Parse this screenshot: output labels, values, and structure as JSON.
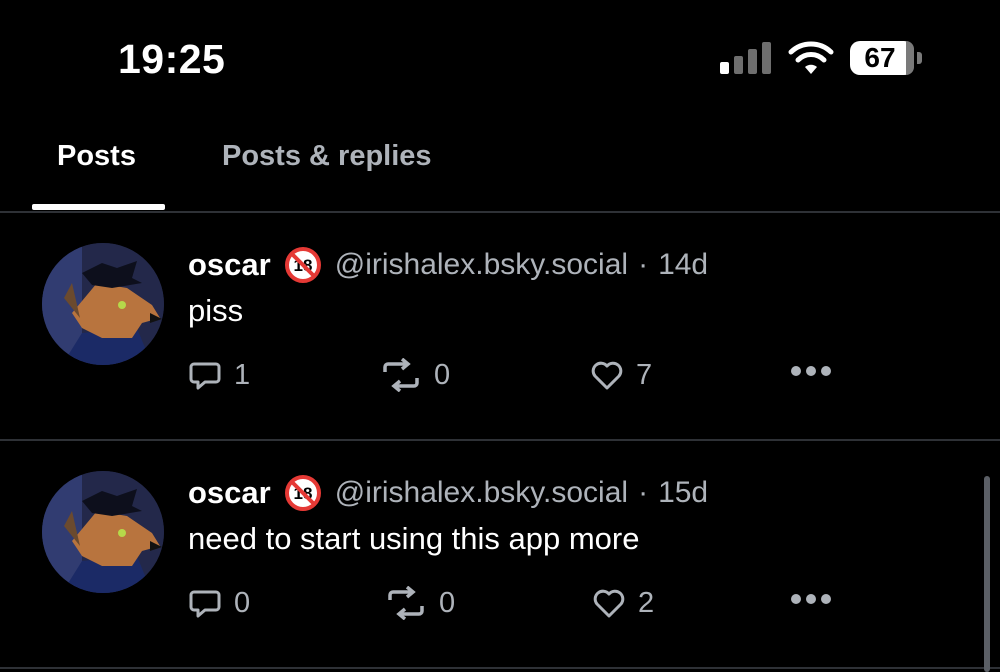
{
  "status_bar": {
    "time": "19:25",
    "battery_level": "67",
    "icons": [
      "cellular-signal-icon",
      "wifi-icon",
      "battery-icon"
    ]
  },
  "tabs": [
    {
      "label": "Posts",
      "selected": true
    },
    {
      "label": "Posts & replies",
      "selected": false
    }
  ],
  "posts": [
    {
      "name": "oscar",
      "badge": "adult-content-18-icon",
      "handle": "@irishalex.bsky.social",
      "separator": "·",
      "time": "14d",
      "text": "piss",
      "replies": "1",
      "reposts": "0",
      "likes": "7"
    },
    {
      "name": "oscar",
      "badge": "adult-content-18-icon",
      "handle": "@irishalex.bsky.social",
      "separator": "·",
      "time": "15d",
      "text": "need to start using this app more",
      "replies": "0",
      "reposts": "0",
      "likes": "2"
    }
  ],
  "colors": {
    "background": "#000000",
    "text_primary": "#ffffff",
    "text_secondary": "#aeb3ba",
    "divider": "#2e3136",
    "badge_red": "#e53935"
  }
}
